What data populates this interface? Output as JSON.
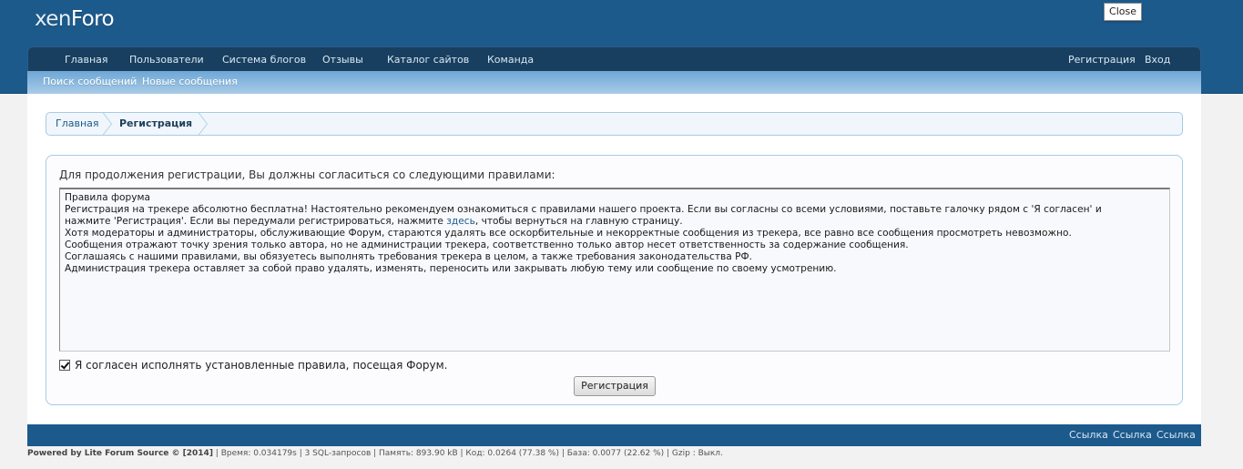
{
  "header": {
    "logo_part1": "xen",
    "logo_part2": "Foro",
    "close_label": "Close"
  },
  "nav": {
    "items": [
      "Главная",
      "Пользователи",
      "Система блогов",
      "Отзывы",
      "Каталог сайтов",
      "Команда"
    ],
    "register": "Регистрация",
    "login": "Вход"
  },
  "subnav": {
    "items": [
      "Поиск сообщений",
      "Новые сообщения"
    ]
  },
  "breadcrumb": {
    "home": "Главная",
    "current": "Регистрация"
  },
  "form": {
    "intro": "Для продолжения регистрации, Вы должны согласиться со следующими правилами:",
    "rules": {
      "title": "Правила форума",
      "line1": "Регистрация на трекере абсолютно бесплатна! Настоятельно рекомендуем ознакомиться с правилами нашего проекта. Если вы согласны со всеми условиями, поставьте галочку рядом с 'Я согласен' и",
      "line2_before": "нажмите 'Регистрация'. Если вы передумали регистрироваться, нажмите ",
      "line2_link": "здесь",
      "line2_after": ", чтобы вернуться на главную страницу.",
      "line3": "Хотя модераторы и администраторы, обслуживающие Форум, стараются удалять все оскорбительные и некорректные сообщения из трекера, все равно все сообщения просмотреть невозможно.",
      "line4": "Сообщения отражают точку зрения только автора, но не администрации трекера, соответственно только автор несет ответственность за содержание сообщения.",
      "line5": "Соглашаясь с нашими правилами, вы обязуетесь выполнять требования трекера в целом, а также требования законодательства РФ.",
      "line6": "Администрация трекера оставляет за собой право удалять, изменять, переносить или закрывать любую тему или сообщение по своему усмотрению."
    },
    "agree_label": "Я согласен исполнять установленные правила, посещая Форум.",
    "agree_checked": true,
    "submit_label": "Регистрация"
  },
  "footer": {
    "links": [
      "Ссылка",
      "Ссылка",
      "Ссылка"
    ],
    "powered_by": "Powered by Lite Forum Source © [2014]",
    "stats": " | Время: 0.034179s | 3 SQL-запросов | Память: 893.90 kB | Код: 0.0264 (77.38 %) | База: 0.0077 (22.62 %) | Gzip : Выкл."
  },
  "colors": {
    "header_bg": "#1d5a8c",
    "navbar_bg": "#183f5f",
    "subnav_gradient_top": "#6ea7d6",
    "border_accent": "#a7cbe3"
  }
}
